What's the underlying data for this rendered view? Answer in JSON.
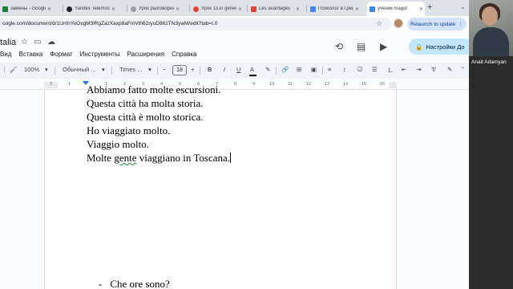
{
  "browser": {
    "tabs": [
      {
        "label": "замены - Google",
        "color": "#188038"
      },
      {
        "label": "Yandex Telemost",
        "color": "#202124"
      },
      {
        "label": "Урок разговорный",
        "color": "#9aa0a6"
      },
      {
        "label": "Урок 13.in general",
        "color": "#ea4335"
      },
      {
        "label": "Les avantages",
        "color": "#db4437"
      },
      {
        "label": "Психолог в Греции",
        "color": "#4285f4"
      },
      {
        "label": "ученик magor",
        "color": "#4285f4"
      }
    ],
    "new_tab": "+",
    "url": "oogle.com/document/d/1UnfnYoOxgM3lRgZazXaxp8aFmVth62ryuD861TN3ywM/edit?tab=t.0",
    "relaunch_label": "Relaunch to update"
  },
  "docs": {
    "title": "talia",
    "menu": [
      "Вид",
      "Вставка",
      "Формат",
      "Инструменты",
      "Расширения",
      "Справка"
    ],
    "settings_label": "Настройки До"
  },
  "toolbar": {
    "zoom": "100%",
    "style": "Обычный ...",
    "font": "Times ...",
    "font_size": "18",
    "minus": "−",
    "plus": "+"
  },
  "ruler": {
    "numbers": [
      "2",
      "1",
      "1",
      "2",
      "3",
      "4",
      "5",
      "6",
      "7",
      "8",
      "9",
      "10",
      "11",
      "12",
      "13",
      "14",
      "15",
      "16",
      "17",
      "18"
    ]
  },
  "document": {
    "line_cut": "Abbiamo fatto molte escursioni.",
    "lines": [
      "Questa città ha molta storia.",
      "Questa città è molto storica.",
      "Ho viaggiato molto.",
      "Viaggio molto."
    ],
    "last_line_before": "Molte ",
    "last_line_spell": "gente",
    "last_line_after": " viaggiano in Toscana.",
    "bullet_dash": "-",
    "bullet_text": "Che ore sono?"
  },
  "meeting": {
    "participant_name": "Anait Adamyan"
  }
}
